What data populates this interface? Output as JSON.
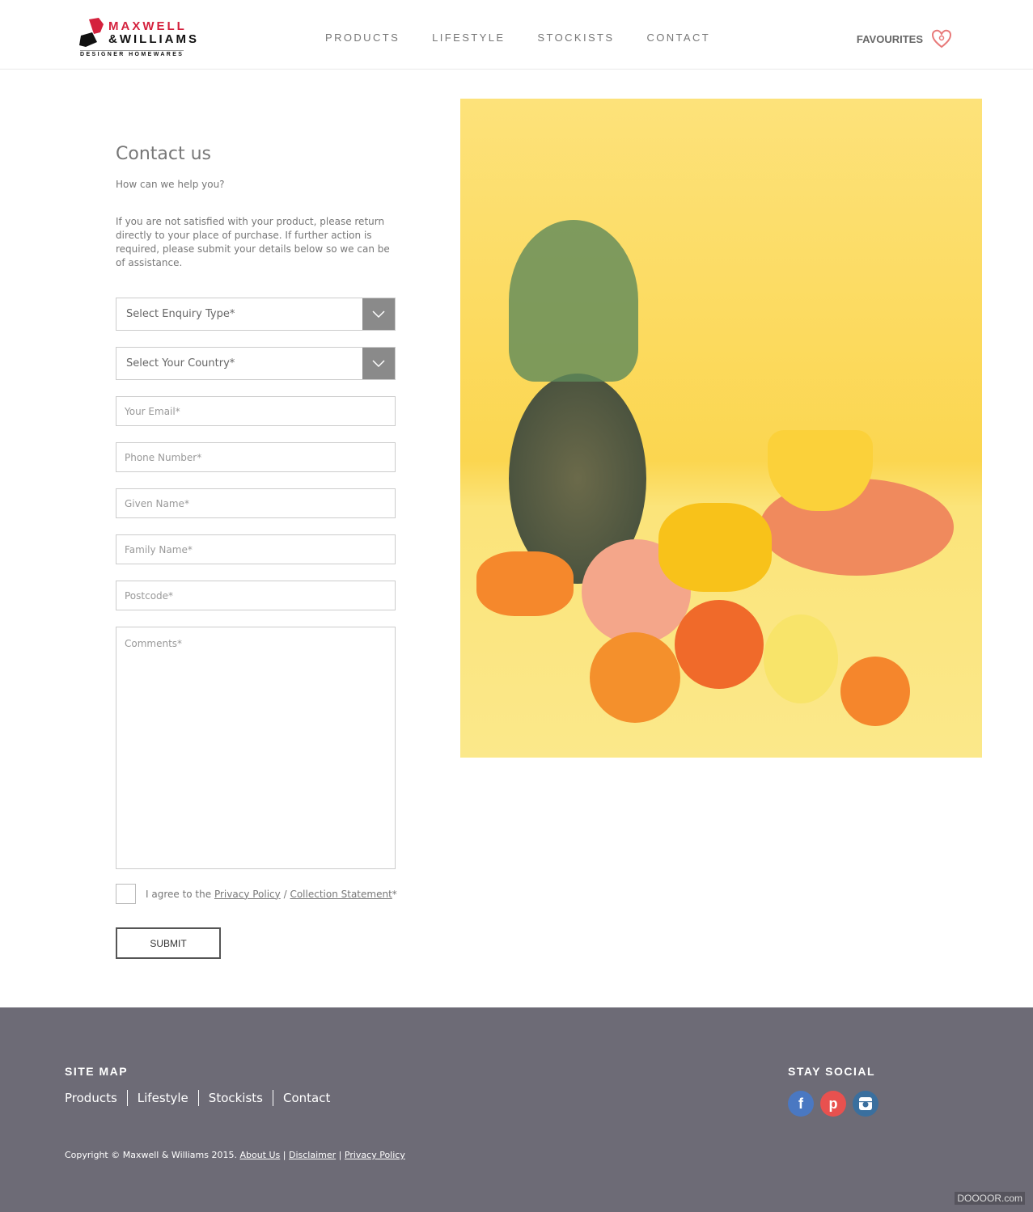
{
  "header": {
    "logo_line1": "MAXWELL",
    "logo_line2": "&WILLIAMS",
    "logo_line3": "DESIGNER HOMEWARES",
    "nav": [
      "PRODUCTS",
      "LIFESTYLE",
      "STOCKISTS",
      "CONTACT"
    ],
    "favourites": "FAVOURITES"
  },
  "contact": {
    "title": "Contact us",
    "subtitle": "How can we help you?",
    "paragraph": "If you are not satisfied with your product, please return directly to your place of purchase. If further action is required, please submit your details below so we can be of assistance.",
    "enquiry_select": "Select Enquiry Type*",
    "country_select": "Select Your Country*",
    "email": "Your Email*",
    "phone": "Phone Number*",
    "given": "Given Name*",
    "family": "Family Name*",
    "postcode": "Postcode*",
    "comments": "Comments*",
    "agree_prefix": "I agree to the",
    "privacy": "Privacy Policy",
    "sep": "/",
    "collection": "Collection Statement",
    "agree_suffix": "*",
    "submit": "SUBMIT"
  },
  "footer": {
    "sitemap": "SITE MAP",
    "links": [
      "Products",
      "Lifestyle",
      "Stockists",
      "Contact"
    ],
    "social_title": "STAY SOCIAL",
    "copyright": "Copyright © Maxwell & Williams 2015.",
    "about": "About Us",
    "disclaimer": "Disclaimer",
    "privacy": "Privacy Policy",
    "pipe": "|"
  },
  "watermark": "DOOOOR.com",
  "colors": {
    "facebook": "#4a78c2",
    "pinterest": "#e8514f",
    "instagram": "#3a6f9e",
    "footer_bg": "#6d6b76",
    "brand_red": "#d4213d"
  }
}
